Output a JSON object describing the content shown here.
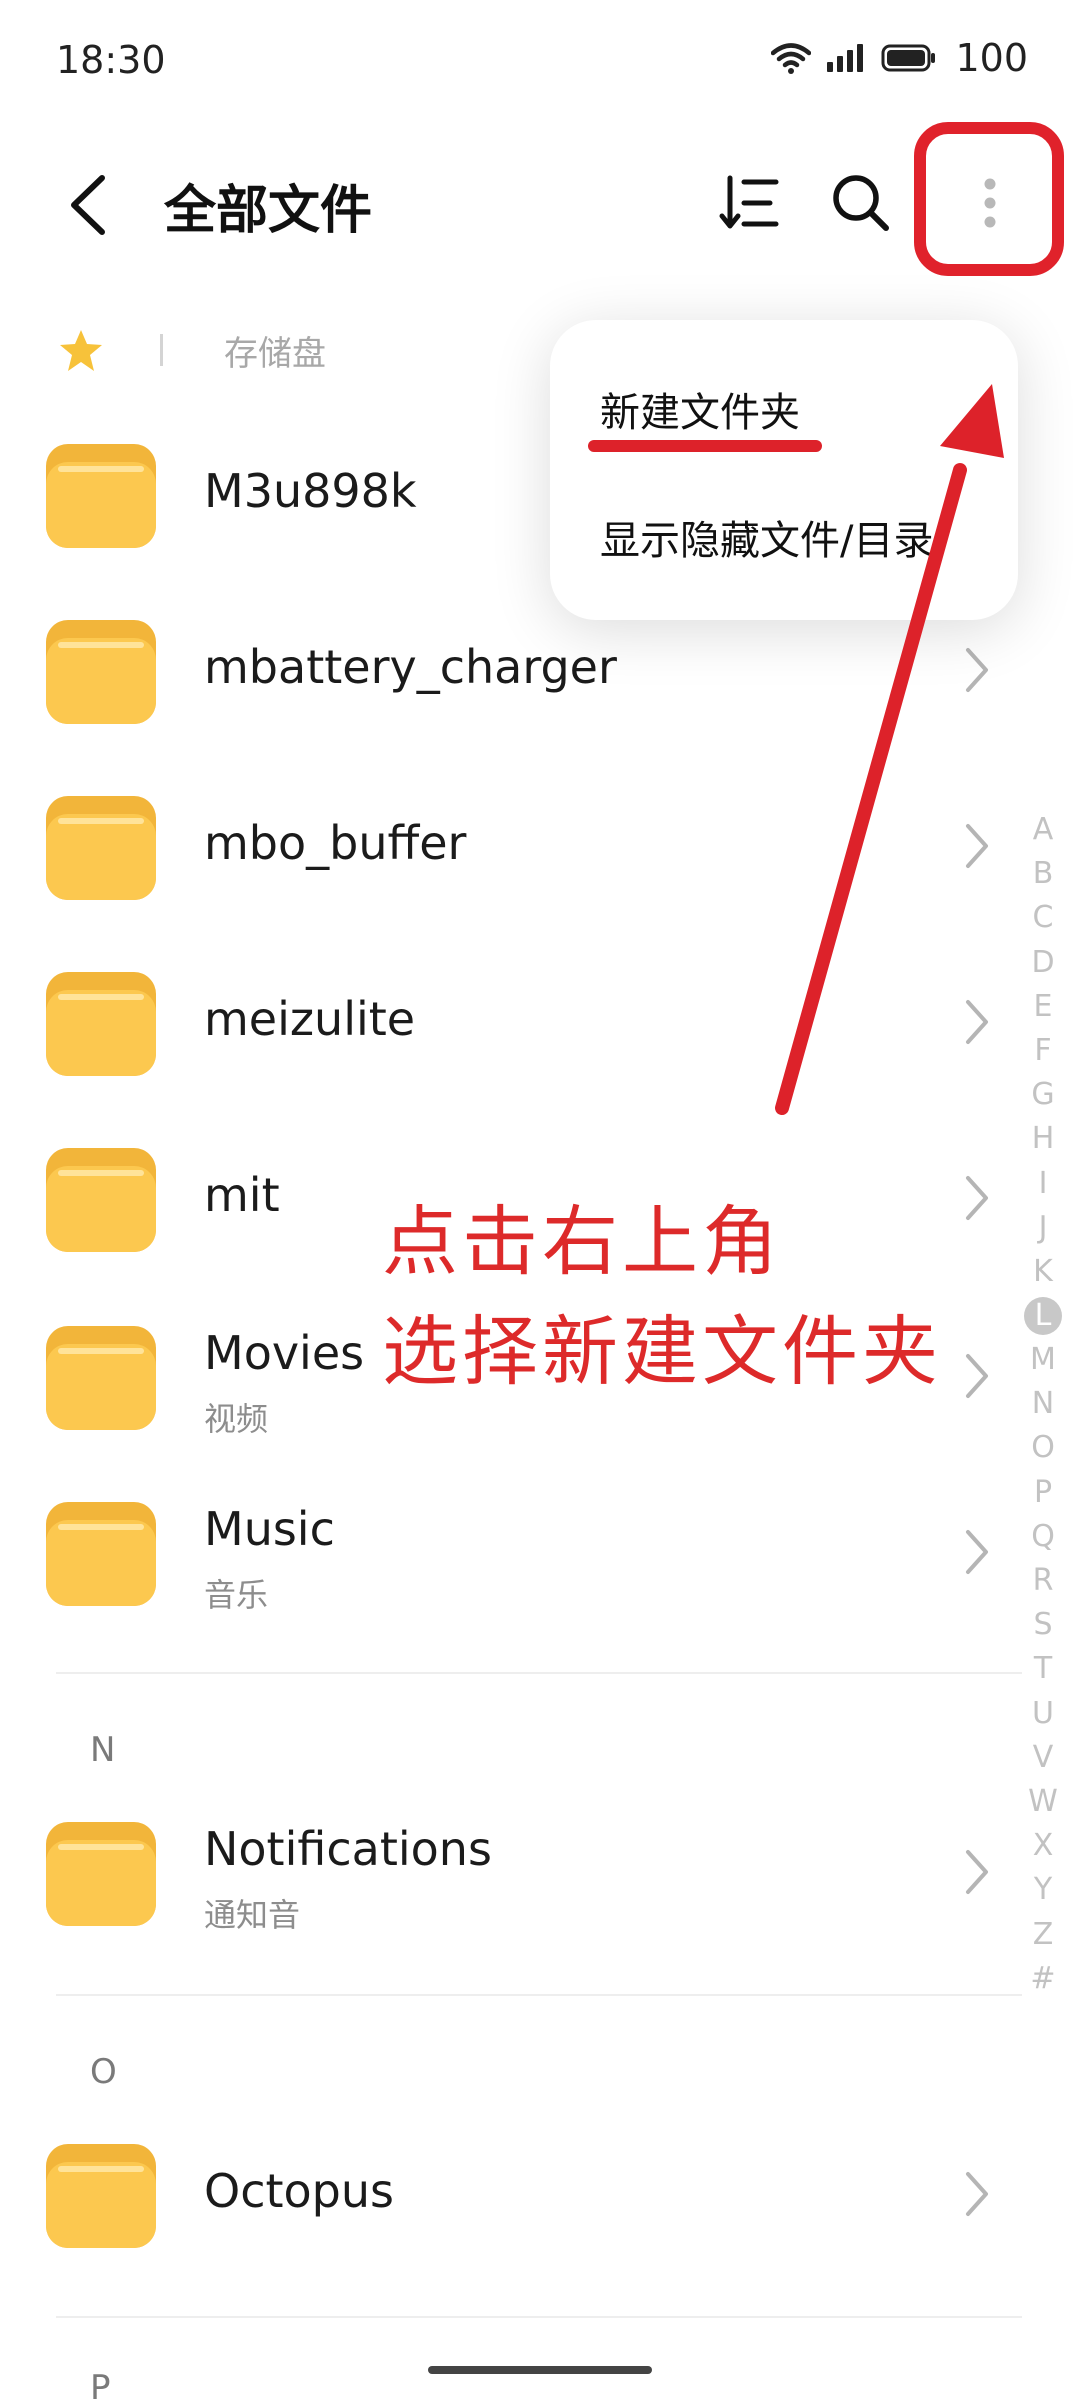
{
  "status": {
    "time": "18:30",
    "battery": "100"
  },
  "header": {
    "title": "全部文件"
  },
  "breadcrumb": {
    "storage": "存储盘"
  },
  "list": [
    {
      "name": "M3u898k",
      "sub": ""
    },
    {
      "name": "mbattery_charger",
      "sub": ""
    },
    {
      "name": "mbo_buffer",
      "sub": ""
    },
    {
      "name": "meizulite",
      "sub": ""
    },
    {
      "name": "mit",
      "sub": ""
    },
    {
      "name": "Movies",
      "sub": "视频"
    },
    {
      "name": "Music",
      "sub": "音乐"
    },
    {
      "name": "Notifications",
      "sub": "通知音"
    },
    {
      "name": "Octopus",
      "sub": ""
    }
  ],
  "sections": {
    "n": "N",
    "o": "O",
    "p": "P"
  },
  "index": [
    "A",
    "B",
    "C",
    "D",
    "E",
    "F",
    "G",
    "H",
    "I",
    "J",
    "K",
    "L",
    "M",
    "N",
    "O",
    "P",
    "Q",
    "R",
    "S",
    "T",
    "U",
    "V",
    "W",
    "X",
    "Y",
    "Z",
    "#"
  ],
  "index_active": "L",
  "menu": {
    "new_folder": "新建文件夹",
    "show_hidden": "显示隐藏文件/目录"
  },
  "annotation": {
    "line1": "点击右上角",
    "line2": "选择新建文件夹"
  },
  "colors": {
    "folder": "#FCC84F",
    "annotation": "#DD222A",
    "star": "#F7C23A"
  }
}
